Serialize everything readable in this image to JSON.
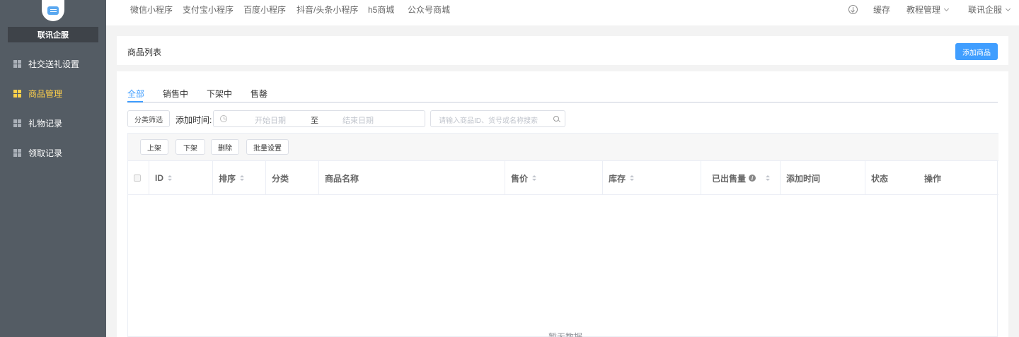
{
  "sidebar": {
    "brand": "联讯企服",
    "items": [
      {
        "label": "社交送礼设置",
        "active": false
      },
      {
        "label": "商品管理",
        "active": true
      },
      {
        "label": "礼物记录",
        "active": false
      },
      {
        "label": "领取记录",
        "active": false
      }
    ]
  },
  "topnav": {
    "links": [
      "微信小程序",
      "支付宝小程序",
      "百度小程序",
      "抖音/头条小程序",
      "h5商城",
      "公众号商城"
    ],
    "cache": "缓存",
    "tutorial": "教程管理",
    "account": "联讯企服"
  },
  "header": {
    "title": "商品列表",
    "add_button": "添加商品"
  },
  "tabs": [
    "全部",
    "销售中",
    "下架中",
    "售罄"
  ],
  "filters": {
    "category_button": "分类筛选",
    "date_label": "添加时间:",
    "date_start_placeholder": "开始日期",
    "date_separator": "至",
    "date_end_placeholder": "结束日期",
    "search_placeholder": "请输入商品ID、货号或名称搜索"
  },
  "batch_actions": [
    "上架",
    "下架",
    "删除",
    "批量设置"
  ],
  "table": {
    "columns": [
      "ID",
      "排序",
      "分类",
      "商品名称",
      "售价",
      "库存",
      "已出售量",
      "添加时间",
      "状态",
      "操作"
    ],
    "empty_text": "暂无数据"
  },
  "colors": {
    "sidebar_bg": "#545c64",
    "active_menu": "#ffd04b",
    "primary": "#409eff"
  }
}
